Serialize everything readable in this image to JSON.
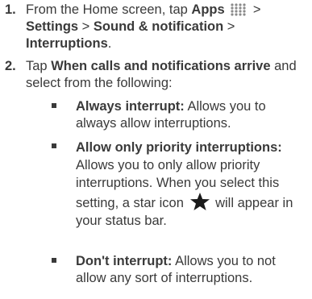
{
  "steps": [
    {
      "number": "1.",
      "t1": "From the Home screen, tap ",
      "b1": "Apps",
      "icon_apps": "apps-grid-icon",
      "t2": " > ",
      "b2": "Settings",
      "t3": " > ",
      "b3": "Sound & notification",
      "t4": " > ",
      "b4": "Interruptions",
      "t5": "."
    },
    {
      "number": "2.",
      "t1": "Tap ",
      "b1": "When calls and notifications arrive",
      "t2": " and select from the following:"
    }
  ],
  "bullets": [
    {
      "title": "Always interrupt:",
      "text": " Allows you to always allow interruptions."
    },
    {
      "title": "Allow only priority interruptions:",
      "text1": " Allows you to only allow priority interruptions. When you select this setting, a star icon ",
      "icon": "star-icon",
      "text2": " will appear in your status bar."
    },
    {
      "title": "Don't interrupt:",
      "text": " Allows you to not allow any sort of interruptions."
    }
  ],
  "colors": {
    "text": "#3a3a3a",
    "star": "#1a1a1a"
  }
}
